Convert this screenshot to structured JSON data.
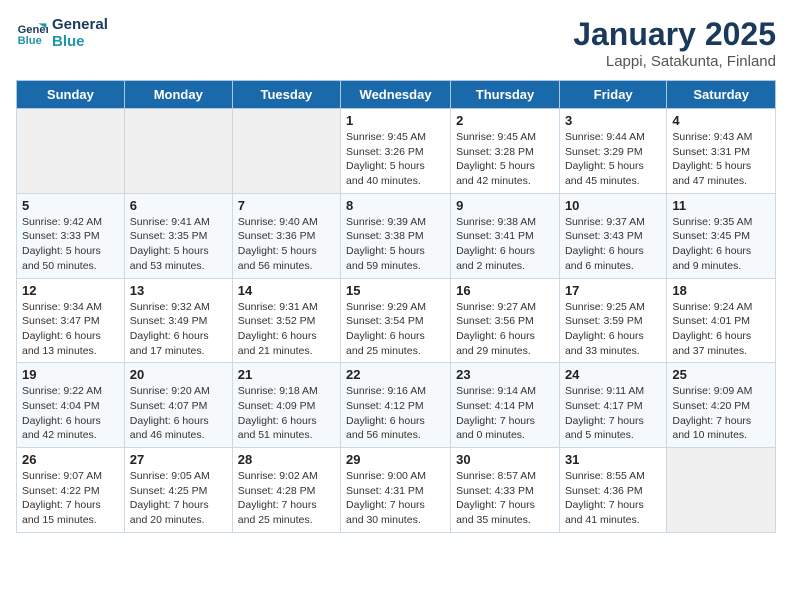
{
  "logo": {
    "line1": "General",
    "line2": "Blue"
  },
  "title": "January 2025",
  "subtitle": "Lappi, Satakunta, Finland",
  "days_of_week": [
    "Sunday",
    "Monday",
    "Tuesday",
    "Wednesday",
    "Thursday",
    "Friday",
    "Saturday"
  ],
  "weeks": [
    [
      {
        "day": "",
        "info": ""
      },
      {
        "day": "",
        "info": ""
      },
      {
        "day": "",
        "info": ""
      },
      {
        "day": "1",
        "info": "Sunrise: 9:45 AM\nSunset: 3:26 PM\nDaylight: 5 hours and 40 minutes."
      },
      {
        "day": "2",
        "info": "Sunrise: 9:45 AM\nSunset: 3:28 PM\nDaylight: 5 hours and 42 minutes."
      },
      {
        "day": "3",
        "info": "Sunrise: 9:44 AM\nSunset: 3:29 PM\nDaylight: 5 hours and 45 minutes."
      },
      {
        "day": "4",
        "info": "Sunrise: 9:43 AM\nSunset: 3:31 PM\nDaylight: 5 hours and 47 minutes."
      }
    ],
    [
      {
        "day": "5",
        "info": "Sunrise: 9:42 AM\nSunset: 3:33 PM\nDaylight: 5 hours and 50 minutes."
      },
      {
        "day": "6",
        "info": "Sunrise: 9:41 AM\nSunset: 3:35 PM\nDaylight: 5 hours and 53 minutes."
      },
      {
        "day": "7",
        "info": "Sunrise: 9:40 AM\nSunset: 3:36 PM\nDaylight: 5 hours and 56 minutes."
      },
      {
        "day": "8",
        "info": "Sunrise: 9:39 AM\nSunset: 3:38 PM\nDaylight: 5 hours and 59 minutes."
      },
      {
        "day": "9",
        "info": "Sunrise: 9:38 AM\nSunset: 3:41 PM\nDaylight: 6 hours and 2 minutes."
      },
      {
        "day": "10",
        "info": "Sunrise: 9:37 AM\nSunset: 3:43 PM\nDaylight: 6 hours and 6 minutes."
      },
      {
        "day": "11",
        "info": "Sunrise: 9:35 AM\nSunset: 3:45 PM\nDaylight: 6 hours and 9 minutes."
      }
    ],
    [
      {
        "day": "12",
        "info": "Sunrise: 9:34 AM\nSunset: 3:47 PM\nDaylight: 6 hours and 13 minutes."
      },
      {
        "day": "13",
        "info": "Sunrise: 9:32 AM\nSunset: 3:49 PM\nDaylight: 6 hours and 17 minutes."
      },
      {
        "day": "14",
        "info": "Sunrise: 9:31 AM\nSunset: 3:52 PM\nDaylight: 6 hours and 21 minutes."
      },
      {
        "day": "15",
        "info": "Sunrise: 9:29 AM\nSunset: 3:54 PM\nDaylight: 6 hours and 25 minutes."
      },
      {
        "day": "16",
        "info": "Sunrise: 9:27 AM\nSunset: 3:56 PM\nDaylight: 6 hours and 29 minutes."
      },
      {
        "day": "17",
        "info": "Sunrise: 9:25 AM\nSunset: 3:59 PM\nDaylight: 6 hours and 33 minutes."
      },
      {
        "day": "18",
        "info": "Sunrise: 9:24 AM\nSunset: 4:01 PM\nDaylight: 6 hours and 37 minutes."
      }
    ],
    [
      {
        "day": "19",
        "info": "Sunrise: 9:22 AM\nSunset: 4:04 PM\nDaylight: 6 hours and 42 minutes."
      },
      {
        "day": "20",
        "info": "Sunrise: 9:20 AM\nSunset: 4:07 PM\nDaylight: 6 hours and 46 minutes."
      },
      {
        "day": "21",
        "info": "Sunrise: 9:18 AM\nSunset: 4:09 PM\nDaylight: 6 hours and 51 minutes."
      },
      {
        "day": "22",
        "info": "Sunrise: 9:16 AM\nSunset: 4:12 PM\nDaylight: 6 hours and 56 minutes."
      },
      {
        "day": "23",
        "info": "Sunrise: 9:14 AM\nSunset: 4:14 PM\nDaylight: 7 hours and 0 minutes."
      },
      {
        "day": "24",
        "info": "Sunrise: 9:11 AM\nSunset: 4:17 PM\nDaylight: 7 hours and 5 minutes."
      },
      {
        "day": "25",
        "info": "Sunrise: 9:09 AM\nSunset: 4:20 PM\nDaylight: 7 hours and 10 minutes."
      }
    ],
    [
      {
        "day": "26",
        "info": "Sunrise: 9:07 AM\nSunset: 4:22 PM\nDaylight: 7 hours and 15 minutes."
      },
      {
        "day": "27",
        "info": "Sunrise: 9:05 AM\nSunset: 4:25 PM\nDaylight: 7 hours and 20 minutes."
      },
      {
        "day": "28",
        "info": "Sunrise: 9:02 AM\nSunset: 4:28 PM\nDaylight: 7 hours and 25 minutes."
      },
      {
        "day": "29",
        "info": "Sunrise: 9:00 AM\nSunset: 4:31 PM\nDaylight: 7 hours and 30 minutes."
      },
      {
        "day": "30",
        "info": "Sunrise: 8:57 AM\nSunset: 4:33 PM\nDaylight: 7 hours and 35 minutes."
      },
      {
        "day": "31",
        "info": "Sunrise: 8:55 AM\nSunset: 4:36 PM\nDaylight: 7 hours and 41 minutes."
      },
      {
        "day": "",
        "info": ""
      }
    ]
  ]
}
